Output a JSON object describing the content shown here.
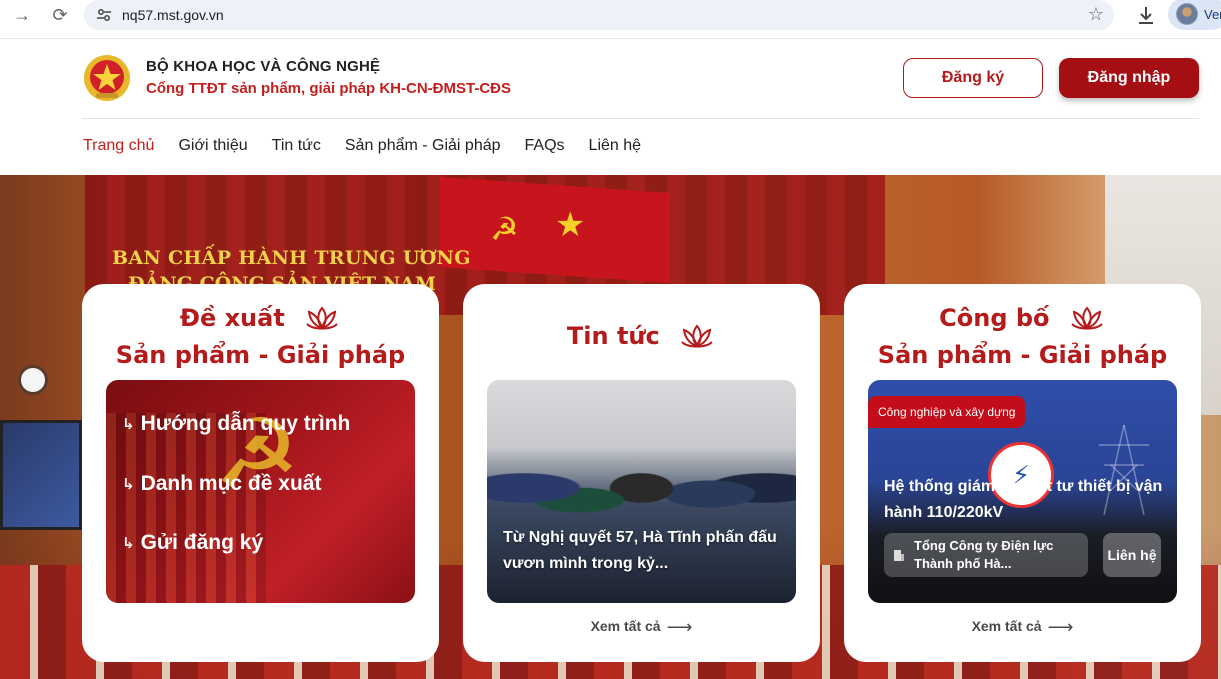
{
  "browser": {
    "url": "nq57.mst.gov.vn",
    "profile_label": "Ver"
  },
  "header": {
    "org_name": "BỘ KHOA HỌC VÀ CÔNG NGHỆ",
    "portal_name": "Cổng TTĐT sản phẩm, giải pháp KH-CN-ĐMST-CĐS",
    "register_label": "Đăng ký",
    "login_label": "Đăng nhập"
  },
  "nav": {
    "items": [
      "Trang chủ",
      "Giới thiệu",
      "Tin tức",
      "Sản phẩm - Giải pháp",
      "FAQs",
      "Liên hệ"
    ],
    "active": "Trang chủ"
  },
  "hero": {
    "banner_line1": "BAN CHẤP HÀNH TRUNG ƯƠNG",
    "banner_line2": "ĐẢNG CỘNG SẢN VIỆT NAM"
  },
  "cards": {
    "propose": {
      "title_line1": "Đề xuất",
      "title_line2": "Sản phẩm - Giải pháp",
      "links": [
        "Hướng dẫn quy trình",
        "Danh mục đề xuất",
        "Gửi đăng ký"
      ]
    },
    "news": {
      "title": "Tin tức",
      "caption": "Từ Nghị quyết 57, Hà Tĩnh phấn đấu vươn mình trong kỷ...",
      "see_all": "Xem tất cả"
    },
    "publish": {
      "title_line1": "Công bố",
      "title_line2": "Sản phẩm - Giải pháp",
      "tag": "Công nghiệp và xây dựng",
      "product_title": "Hệ thống giám sát Vật tư thiết bị vận hành 110/220kV",
      "company": "Tổng Công ty Điện lực Thành phố Hà...",
      "contact_label": "Liên hệ",
      "see_all": "Xem tất cả"
    }
  },
  "colors": {
    "brand_red": "#b51b1b",
    "login_bg": "#a50e12",
    "tag_red": "#c40d1a"
  },
  "icons": [
    "back-arrow-icon",
    "reload-icon",
    "site-settings-icon",
    "bookmark-star-icon",
    "download-icon",
    "emblem-icon",
    "lotus-icon",
    "hook-arrow-icon",
    "arrow-right-icon",
    "building-icon"
  ]
}
